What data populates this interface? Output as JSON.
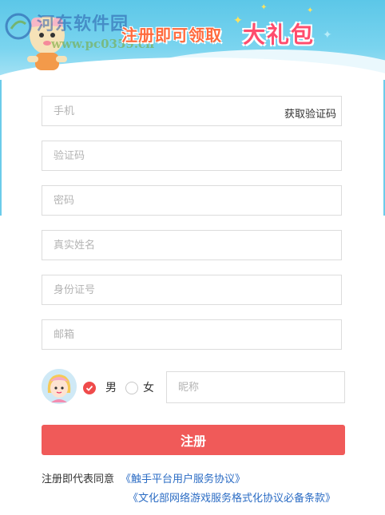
{
  "banner": {
    "watermark_name": "河东软件园",
    "watermark_url": "www.pc0359.cn",
    "slogan": "注册即可领取",
    "slogan_big": "大礼包"
  },
  "form": {
    "phone_placeholder": "手机",
    "get_code_label": "获取验证码",
    "code_placeholder": "验证码",
    "password_placeholder": "密码",
    "realname_placeholder": "真实姓名",
    "idcard_placeholder": "身份证号",
    "email_placeholder": "邮箱",
    "gender": {
      "male_label": "男",
      "female_label": "女",
      "selected": "男"
    },
    "nickname_placeholder": "昵称",
    "submit_label": "注册"
  },
  "agreement": {
    "prefix": "注册即代表同意",
    "link1": "《触手平台用户服务协议》",
    "link2": "《文化部网络游戏服务格式化协议必备条款》"
  },
  "colors": {
    "accent": "#f05a59",
    "link": "#2b6cc4",
    "banner": "#5cc7e8"
  }
}
